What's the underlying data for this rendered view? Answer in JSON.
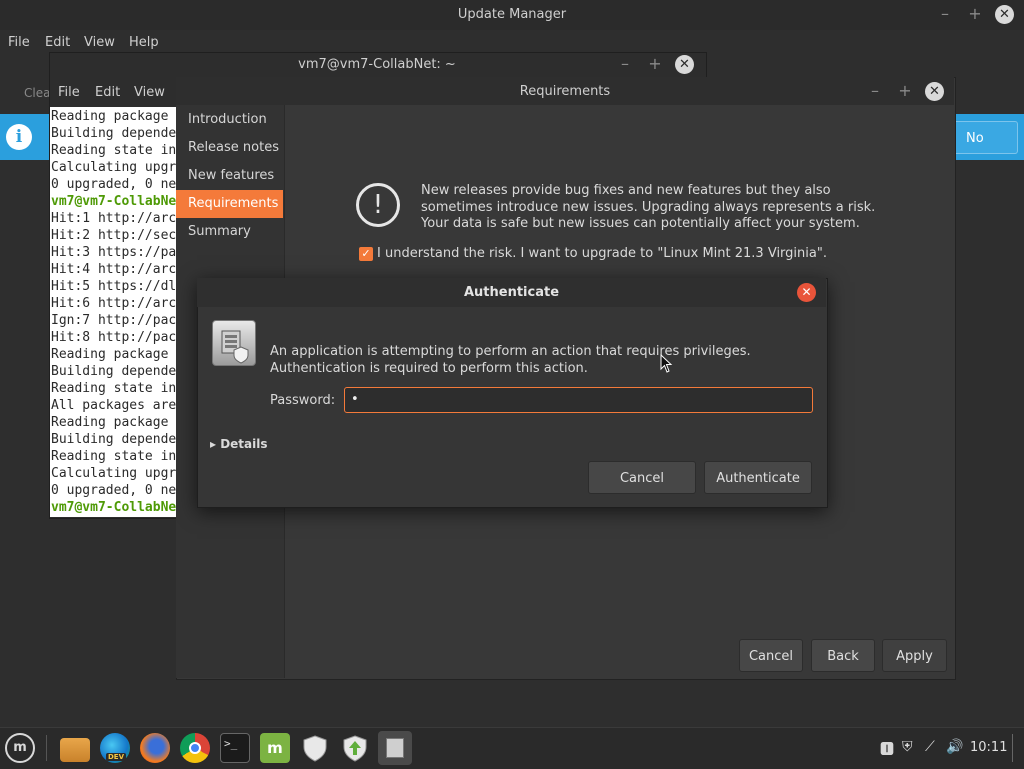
{
  "update_manager": {
    "title": "Update Manager",
    "menu": [
      "File",
      "Edit",
      "View",
      "Help"
    ],
    "toolbar_clear_label": "Clea",
    "infobar_no_label": "No"
  },
  "terminal": {
    "title": "vm7@vm7-CollabNet: ~",
    "menu": [
      "File",
      "Edit",
      "View"
    ],
    "lines": [
      {
        "text": "Reading package",
        "prompt": false
      },
      {
        "text": "Building depende",
        "prompt": false
      },
      {
        "text": "Reading state in",
        "prompt": false
      },
      {
        "text": "Calculating upgr",
        "prompt": false
      },
      {
        "text": "0 upgraded, 0 ne",
        "prompt": false
      },
      {
        "text": "vm7@vm7-CollabNe",
        "prompt": true
      },
      {
        "text": "Hit:1 http://arc",
        "prompt": false
      },
      {
        "text": "Hit:2 http://sec",
        "prompt": false
      },
      {
        "text": "Hit:3 https://pa",
        "prompt": false
      },
      {
        "text": "Hit:4 http://arc",
        "prompt": false
      },
      {
        "text": "Hit:5 https://dl",
        "prompt": false
      },
      {
        "text": "Hit:6 http://arc",
        "prompt": false
      },
      {
        "text": "Ign:7 http://pac",
        "prompt": false
      },
      {
        "text": "Hit:8 http://pac",
        "prompt": false
      },
      {
        "text": "Reading package",
        "prompt": false
      },
      {
        "text": "Building depende",
        "prompt": false
      },
      {
        "text": "Reading state in",
        "prompt": false
      },
      {
        "text": "All packages are",
        "prompt": false
      },
      {
        "text": "Reading package",
        "prompt": false
      },
      {
        "text": "Building depende",
        "prompt": false
      },
      {
        "text": "Reading state in",
        "prompt": false
      },
      {
        "text": "Calculating upgr",
        "prompt": false
      },
      {
        "text": "0 upgraded, 0 ne",
        "prompt": false
      },
      {
        "text": "vm7@vm7-CollabNe",
        "prompt": true
      }
    ]
  },
  "requirements": {
    "title": "Requirements",
    "sidebar": [
      "Introduction",
      "Release notes",
      "New features",
      "Requirements",
      "Summary"
    ],
    "active_index": 3,
    "warning_text": "New releases provide bug fixes and new features but they also sometimes introduce new issues. Upgrading always represents a risk. Your data is safe but new issues can potentially affect your system.",
    "risk_checkbox_label": "I understand the risk. I want to upgrade to \"Linux Mint 21.3 Virginia\".",
    "risk_checked": true,
    "buttons": {
      "cancel": "Cancel",
      "back": "Back",
      "apply": "Apply"
    }
  },
  "auth": {
    "title": "Authenticate",
    "message": "An application is attempting to perform an action that requires privileges. Authentication is required to perform this action.",
    "password_label": "Password:",
    "password_value": "•",
    "details_label": "Details",
    "cancel_label": "Cancel",
    "authenticate_label": "Authenticate"
  },
  "taskbar": {
    "clock": "10:11",
    "dev_badge": "DEV",
    "icons": [
      "mint-menu-icon",
      "files-icon",
      "edge-browser-icon",
      "firefox-icon",
      "chrome-icon",
      "terminal-icon",
      "mintinstall-icon",
      "shield-icon",
      "update-manager-icon",
      "auth-window-icon"
    ]
  }
}
